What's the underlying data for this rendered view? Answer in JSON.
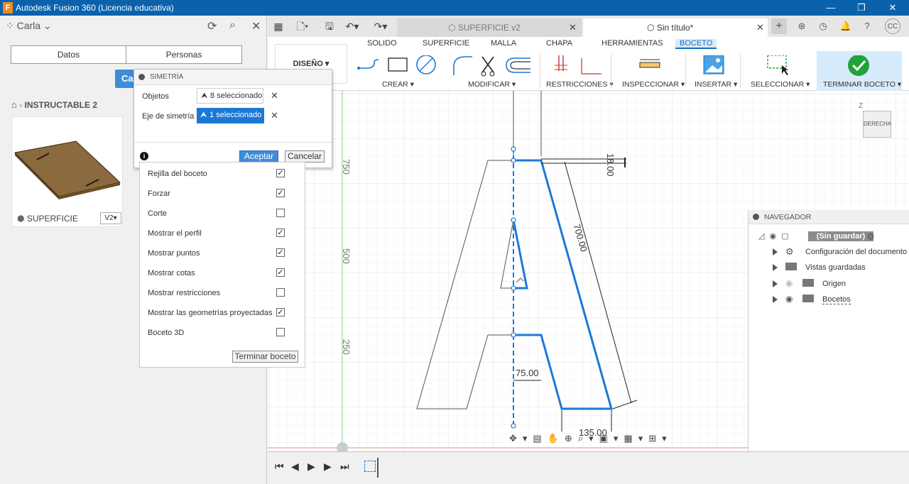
{
  "window": {
    "title": "Autodesk Fusion 360 (Licencia educativa)",
    "app_icon": "F",
    "controls": [
      "—",
      "❐",
      "✕"
    ]
  },
  "data_panel": {
    "user": "Carla",
    "tabs": [
      "Datos",
      "Personas"
    ],
    "blue_button": "Ca",
    "breadcrumb": "INSTRUCTABLE 2",
    "card": {
      "name": "SUPERFICIE",
      "version": "V2▾"
    }
  },
  "doc_tabs": [
    {
      "label": "SUPERFICIE v2",
      "active": false
    },
    {
      "label": "Sin título*",
      "active": true
    }
  ],
  "ribbon": {
    "workspace": "DISEÑO ▾",
    "tabs": [
      "SOLIDO",
      "SUPERFICIE",
      "MALLA",
      "CHAPA",
      "HERRAMIENTAS",
      "BOCETO"
    ],
    "active_tab": "BOCETO",
    "groups": [
      "CREAR ▾",
      "MODIFICAR ▾",
      "RESTRICCIONES ▾",
      "INSPECCIONAR ▾",
      "INSERTAR ▾",
      "SELECCIONAR ▾",
      "TERMINAR BOCETO ▾"
    ]
  },
  "symmetry_dialog": {
    "title": "SIMETRÍA",
    "objects_label": "Objetos",
    "objects_value": "8 seleccionado",
    "axis_label": "Eje de simetría",
    "axis_value": "1 seleccionado",
    "ok": "Aceptar",
    "cancel": "Cancelar"
  },
  "sketch_palette": {
    "options": [
      {
        "label": "Rejilla del boceto",
        "checked": true
      },
      {
        "label": "Forzar",
        "checked": true
      },
      {
        "label": "Corte",
        "checked": false
      },
      {
        "label": "Mostrar el perfil",
        "checked": true
      },
      {
        "label": "Mostrar puntos",
        "checked": true
      },
      {
        "label": "Mostrar cotas",
        "checked": true
      },
      {
        "label": "Mostrar restricciones",
        "checked": false
      },
      {
        "label": "Mostrar las geometrías proyectadas",
        "checked": true
      },
      {
        "label": "Boceto 3D",
        "checked": false
      }
    ],
    "finish": "Terminar boceto"
  },
  "canvas": {
    "ruler": [
      "750",
      "500",
      "250"
    ],
    "dims": [
      "18.00",
      "700.00",
      "75.00",
      "135.00"
    ],
    "viewcube": "DERECHA",
    "axis_z": "Z"
  },
  "navigator": {
    "title": "NAVEGADOR",
    "root": "(Sin guardar)",
    "items": [
      "Configuración del documento",
      "Vistas guardadas",
      "Origen",
      "Bocetos"
    ]
  },
  "colors": {
    "titlebar": "#0a62ad",
    "accent": "#1a6ec0",
    "sketch": "#1b79d6",
    "confirm": "#21a33a"
  }
}
